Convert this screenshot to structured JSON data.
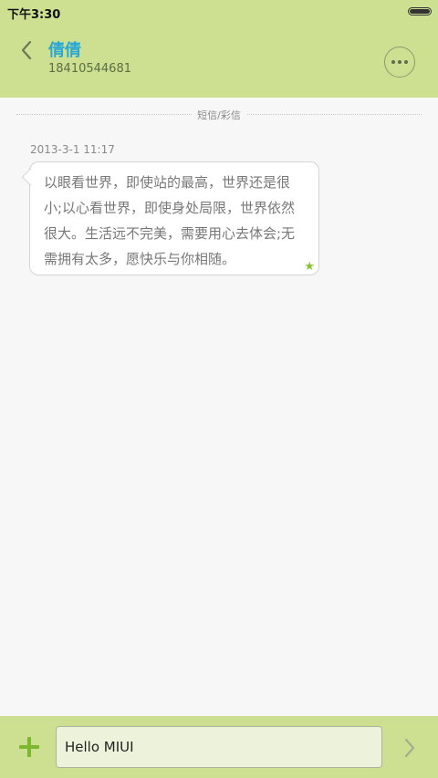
{
  "status_bar": {
    "time": "下午3:30",
    "battery_level": 1.0
  },
  "header": {
    "contact_name": "倩倩",
    "contact_number": "18410544681",
    "back_icon": "chevron-left-icon",
    "more_icon": "more-dots-icon"
  },
  "conversation": {
    "divider_label": "短信/彩信",
    "timestamp": "2013-3-1 11:17",
    "message": "以眼看世界，即使站的最高，世界还是很小;以心看世界，即使身处局限，世界依然很大。生活远不完美，需要用心去体会;无需拥有太多，愿快乐与你相随。",
    "starred": true,
    "star_glyph": "★"
  },
  "input_bar": {
    "input_value": "Hello MIUI",
    "add_icon": "plus-icon",
    "send_icon": "chevron-right-icon"
  },
  "colors": {
    "accent": "#cde092",
    "name": "#2aa7d6",
    "star": "#86c232",
    "plus": "#7cb82f"
  }
}
